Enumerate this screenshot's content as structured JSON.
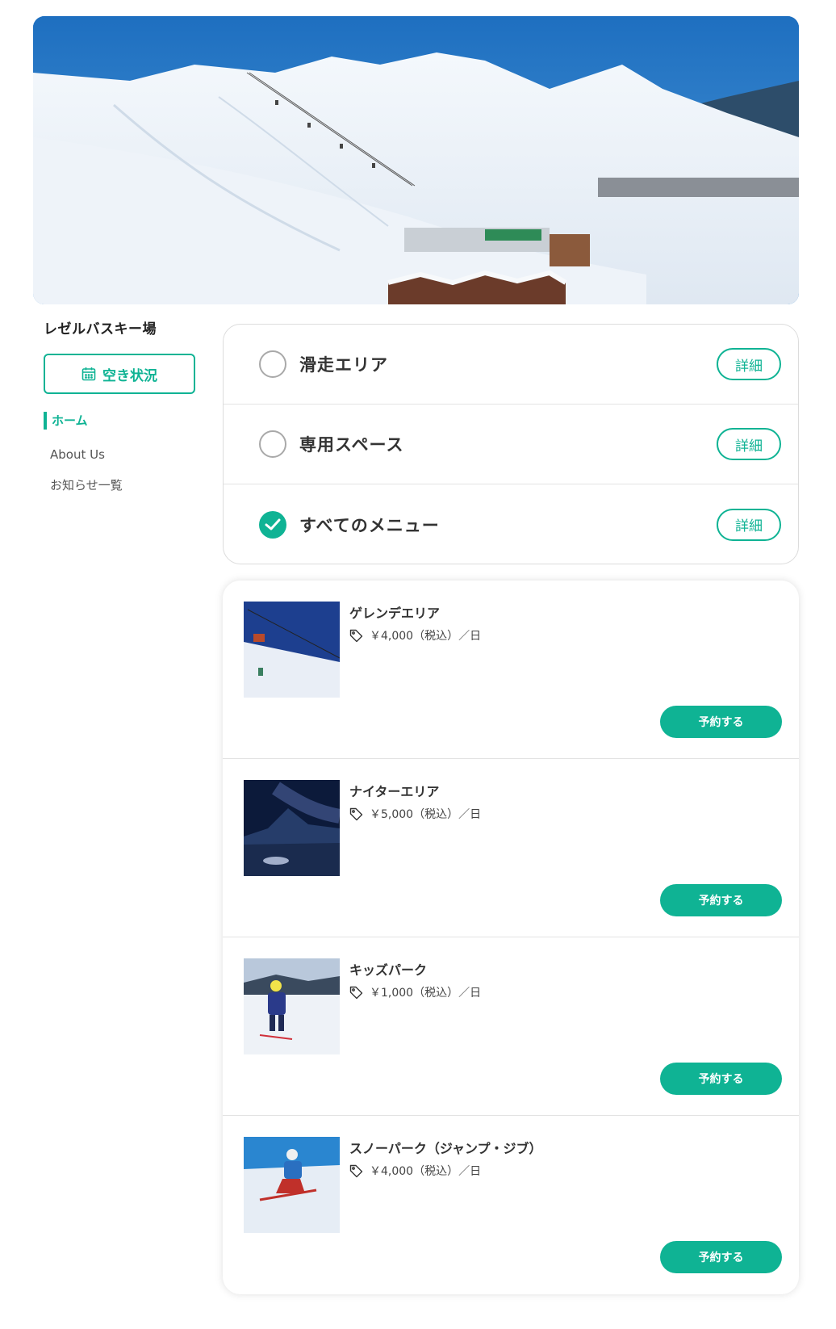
{
  "hero": {
    "alt": ""
  },
  "sidebar": {
    "facility_name": "レゼルバスキー場",
    "availability_button": "空き状況",
    "nav": [
      {
        "label": "ホーム",
        "active": true
      },
      {
        "label": "About Us",
        "active": false
      },
      {
        "label": "お知らせ一覧",
        "active": false
      }
    ]
  },
  "filters": [
    {
      "label": "滑走エリア",
      "checked": false,
      "detail": "詳細"
    },
    {
      "label": "専用スペース",
      "checked": false,
      "detail": "詳細"
    },
    {
      "label": "すべてのメニュー",
      "checked": true,
      "detail": "詳細"
    }
  ],
  "menu_items": [
    {
      "title": "ゲレンデエリア",
      "price": "￥4,000（税込）／日",
      "button": "予約する"
    },
    {
      "title": "ナイターエリア",
      "price": "￥5,000（税込）／日",
      "button": "予約する"
    },
    {
      "title": "キッズパーク",
      "price": "￥1,000（税込）／日",
      "button": "予約する"
    },
    {
      "title": "スノーパーク（ジャンプ・ジブ）",
      "price": "￥4,000（税込）／日",
      "button": "予約する"
    }
  ],
  "icons": {
    "calendar": "calendar-icon",
    "tag": "price-tag-icon",
    "check": "check-icon"
  },
  "colors": {
    "accent": "#0fb394",
    "text": "#333333",
    "border": "#dcdcdc"
  }
}
